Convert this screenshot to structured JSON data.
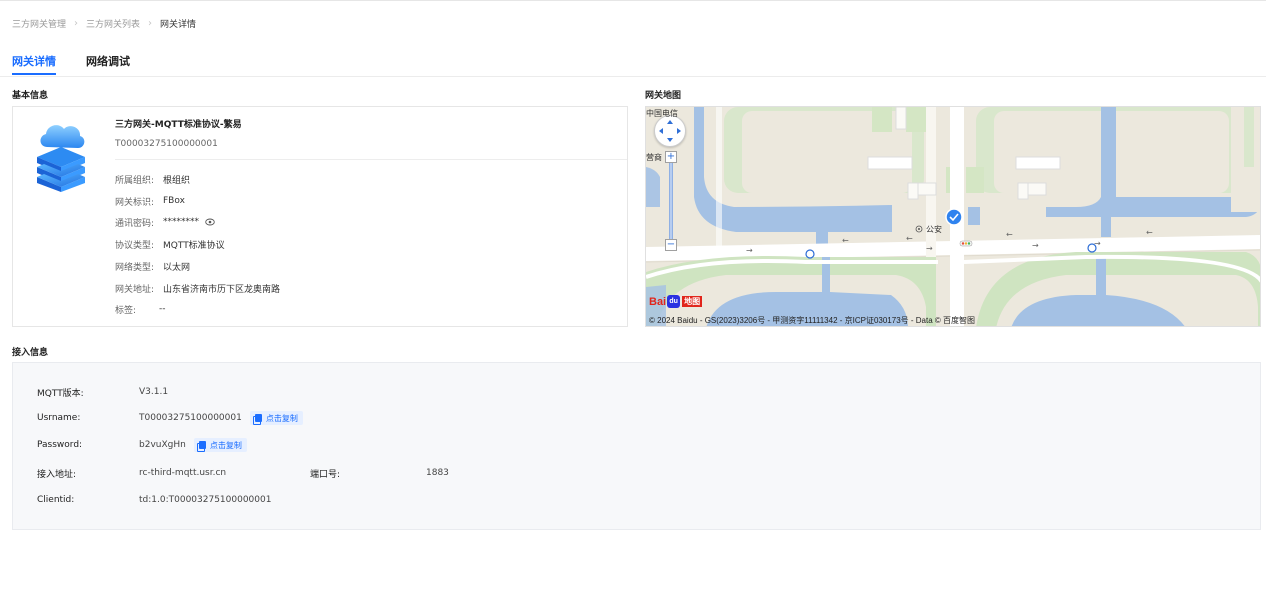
{
  "breadcrumb": {
    "items": [
      "三方网关管理",
      "三方网关列表",
      "网关详情"
    ]
  },
  "tabs": [
    {
      "label": "网关详情",
      "active": true
    },
    {
      "label": "网络调试",
      "active": false
    }
  ],
  "sections": {
    "basic_info": "基本信息",
    "gateway_map": "网关地图",
    "access_info": "接入信息"
  },
  "gateway": {
    "name": "三方网关-MQTT标准协议-繁易",
    "sn": "T00003275100000001",
    "fields": [
      {
        "label": "所属组织:",
        "value": "根组织"
      },
      {
        "label": "网关标识:",
        "value": "FBox"
      },
      {
        "label": "通讯密码:",
        "value": "********"
      },
      {
        "label": "协议类型:",
        "value": "MQTT标准协议"
      },
      {
        "label": "网络类型:",
        "value": "以太网"
      },
      {
        "label": "网关地址:",
        "value": "山东省济南市历下区龙奥南路"
      },
      {
        "label": "标签:",
        "value": "--"
      }
    ]
  },
  "map": {
    "labels": {
      "top_left": "中国电信",
      "left_mid": "营商",
      "poi": "公安"
    },
    "copyright": "© 2024 Baidu - GS(2023)3206号 - 甲测资字11111342 - 京ICP证030173号 - Data © 百度智图",
    "logo_text": "Bai",
    "logo_paw": "du",
    "logo_ditu": "地图",
    "colors": {
      "land": "#ece8dd",
      "water": "#a4c1e4",
      "green": "#cfe4c1",
      "road": "#ffffff"
    }
  },
  "access": {
    "mqtt_version": {
      "label": "MQTT版本:",
      "value": "V3.1.1"
    },
    "username": {
      "label": "Usrname:",
      "value": "T00003275100000001"
    },
    "password": {
      "label": "Password:",
      "value": "b2vuXgHn"
    },
    "address": {
      "label": "接入地址:",
      "value": "rc-third-mqtt.usr.cn"
    },
    "port": {
      "label": "端口号:",
      "value": "1883"
    },
    "clientid": {
      "label": "Clientid:",
      "value": "td:1.0:T00003275100000001"
    },
    "copy_label": "点击复制"
  },
  "colors": {
    "accent": "#1a6dff"
  }
}
